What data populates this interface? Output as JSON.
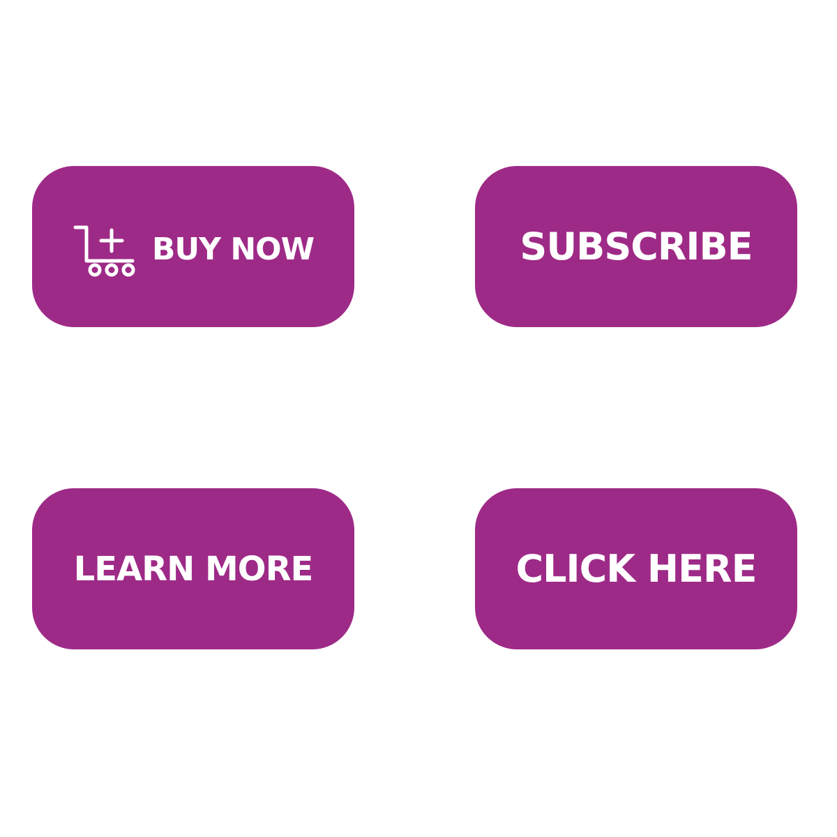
{
  "theme": {
    "button_color": "#9e2a87",
    "text_color": "#ffffff",
    "background": "#ffffff"
  },
  "buttons": {
    "buy_now": {
      "label": "BUY NOW",
      "icon": "cart-plus-icon"
    },
    "subscribe": {
      "label": "SUBSCRIBE"
    },
    "learn_more": {
      "label": "LEARN MORE"
    },
    "click_here": {
      "label": "CLICK HERE"
    }
  }
}
